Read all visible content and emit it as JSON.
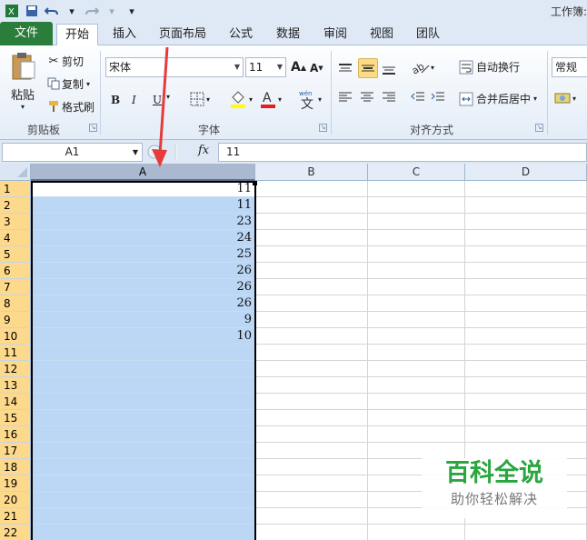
{
  "title_bar": {
    "title": "工作簿:"
  },
  "ribbon_tabs": [
    "文件",
    "开始",
    "插入",
    "页面布局",
    "公式",
    "数据",
    "审阅",
    "视图",
    "团队"
  ],
  "clipboard": {
    "paste": "粘贴",
    "cut": "剪切",
    "copy": "复制",
    "format_painter": "格式刷",
    "group": "剪贴板"
  },
  "font": {
    "name": "宋体",
    "size": "11",
    "group": "字体",
    "bold": "B",
    "italic": "I",
    "underline": "U"
  },
  "alignment": {
    "wrap": "自动换行",
    "merge": "合并后居中",
    "group": "对齐方式"
  },
  "number": {
    "format": "常规"
  },
  "formula_bar": {
    "name_box": "A1",
    "fx": "fx",
    "value": "11"
  },
  "grid": {
    "columns": [
      "A",
      "B",
      "C",
      "D"
    ],
    "rows": [
      "1",
      "2",
      "3",
      "4",
      "5",
      "6",
      "7",
      "8",
      "9",
      "10",
      "11",
      "12",
      "13",
      "14",
      "15",
      "16",
      "17",
      "18",
      "19",
      "20",
      "21",
      "22"
    ],
    "column_a_values": [
      "11",
      "11",
      "23",
      "24",
      "25",
      "26",
      "26",
      "26",
      "9",
      "10",
      "",
      "",
      "",
      "",
      "",
      "",
      "",
      "",
      "",
      "",
      "",
      ""
    ],
    "selected_column": "A",
    "active_cell": "A1"
  },
  "watermark": {
    "title": "百科全说",
    "subtitle": "助你轻松解决"
  },
  "colors": {
    "file_tab": "#2a7d3a",
    "selection": "#bbd7f5",
    "arrow": "#e53b3b",
    "watermark": "#2aa63f"
  },
  "icons": [
    "excel-icon",
    "save-icon",
    "undo-icon",
    "redo-icon",
    "paste-icon",
    "scissors-icon",
    "copy-icon",
    "brush-icon",
    "fx-icon"
  ]
}
